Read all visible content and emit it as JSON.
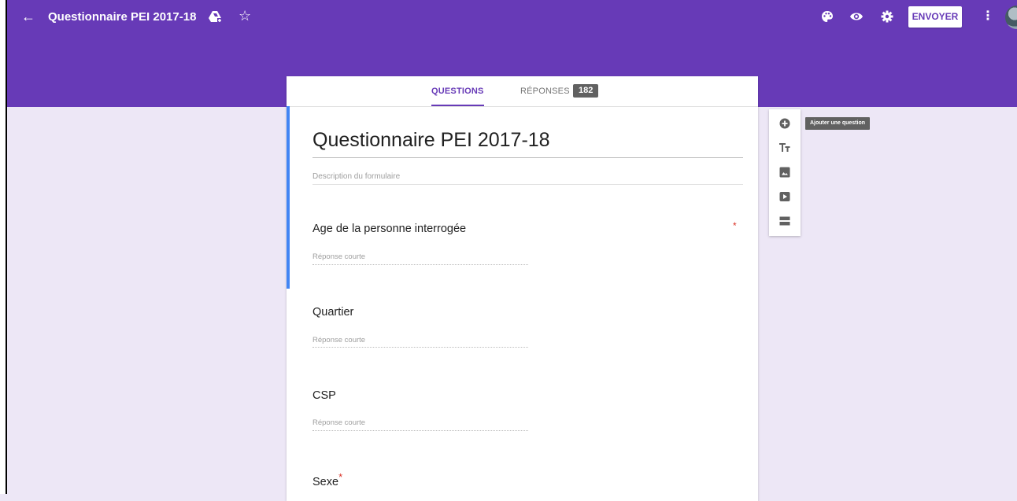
{
  "header": {
    "back_icon": "arrow-back-icon",
    "title": "Questionnaire PEI 2017-18",
    "send_label": "ENVOYER",
    "accent_color": "#673ab7"
  },
  "tabs": {
    "questions_label": "QUESTIONS",
    "responses_label": "RÉPONSES",
    "responses_count": "182"
  },
  "form": {
    "title": "Questionnaire PEI 2017-18",
    "description_placeholder": "Description du formulaire",
    "questions": [
      {
        "title": "Age de la personne interrogée",
        "required": true,
        "placeholder": "Réponse courte"
      },
      {
        "title": "Quartier",
        "required": false,
        "placeholder": "Réponse courte"
      },
      {
        "title": "CSP",
        "required": false,
        "placeholder": "Réponse courte"
      },
      {
        "title": "Sexe",
        "required": true
      }
    ],
    "required_mark": "*"
  },
  "toolbox": {
    "tooltip": "Ajouter une question",
    "tools": [
      "add-question-icon",
      "title-text-icon",
      "image-icon",
      "video-icon",
      "section-icon"
    ]
  }
}
